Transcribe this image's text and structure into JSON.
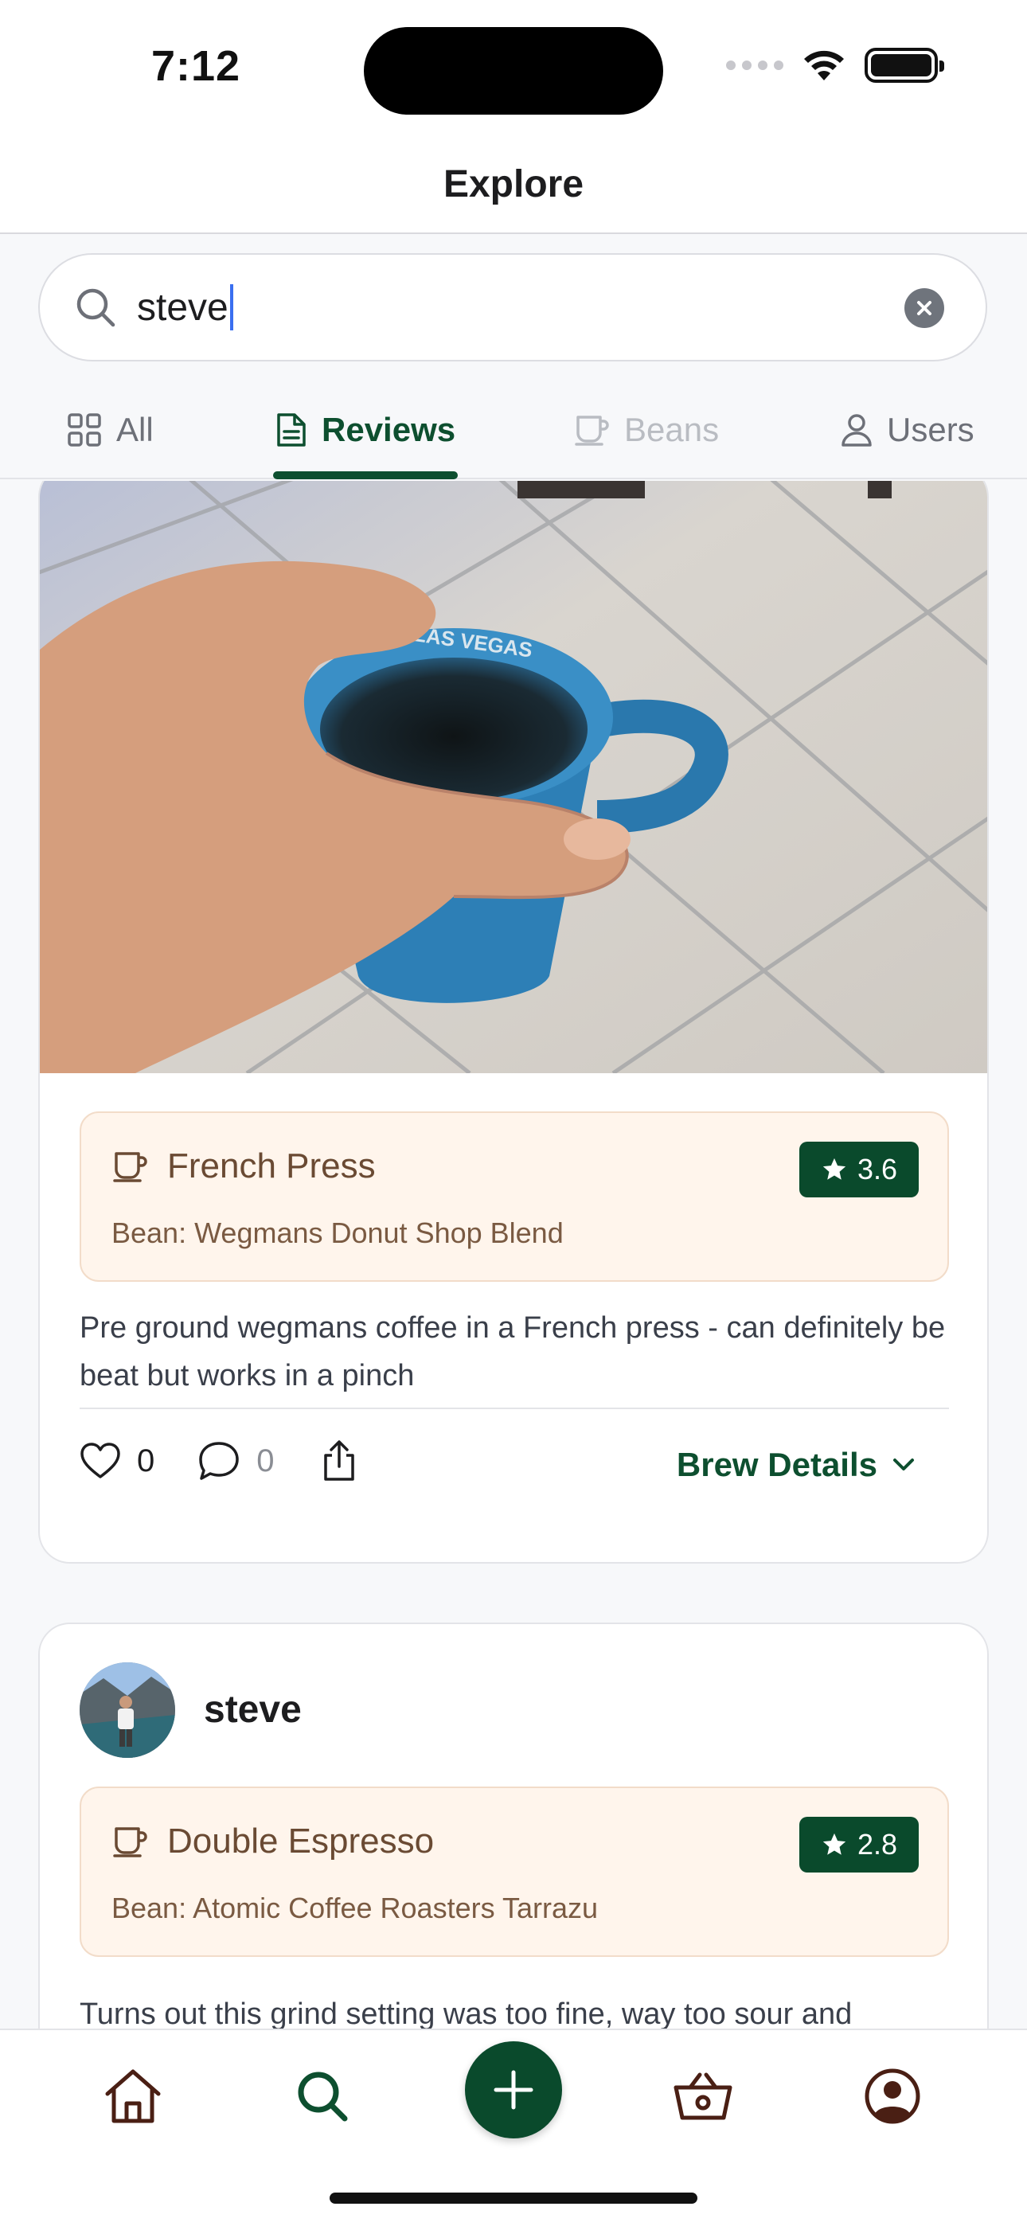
{
  "status_bar": {
    "time": "7:12"
  },
  "header": {
    "title": "Explore"
  },
  "search": {
    "value": "steve",
    "placeholder": ""
  },
  "tabs": [
    {
      "label": "All",
      "icon": "grid-icon",
      "state": "normal"
    },
    {
      "label": "Reviews",
      "icon": "document-icon",
      "state": "active"
    },
    {
      "label": "Beans",
      "icon": "cup-icon",
      "state": "disabled"
    },
    {
      "label": "Users",
      "icon": "user-icon",
      "state": "normal"
    }
  ],
  "reviews": [
    {
      "user": "",
      "photo": "blue Las Vegas mug of coffee",
      "photo_text": "LAS VEGAS",
      "method": "French Press",
      "bean_label": "Bean:",
      "bean": "Wegmans Donut Shop Blend",
      "rating": "3.6",
      "text": "Pre ground wegmans coffee in a French press - can definitely be beat but works in a pinch",
      "likes": "0",
      "comments": "0",
      "details_label": "Brew Details"
    },
    {
      "user": "steve",
      "method": "Double Espresso",
      "bean_label": "Bean:",
      "bean": "Atomic Coffee Roasters Tarrazu",
      "rating": "2.8",
      "text": "Turns out this grind setting was too fine, way too sour and"
    }
  ],
  "tabbar": {
    "items": [
      "home-icon",
      "search-icon",
      "add-icon",
      "basket-icon",
      "profile-icon"
    ]
  },
  "colors": {
    "accent": "#0d4f2f",
    "rating_bg": "#0a4a2c",
    "brew_box_bg": "#fff5ec",
    "brown_text": "#6a4a33"
  }
}
